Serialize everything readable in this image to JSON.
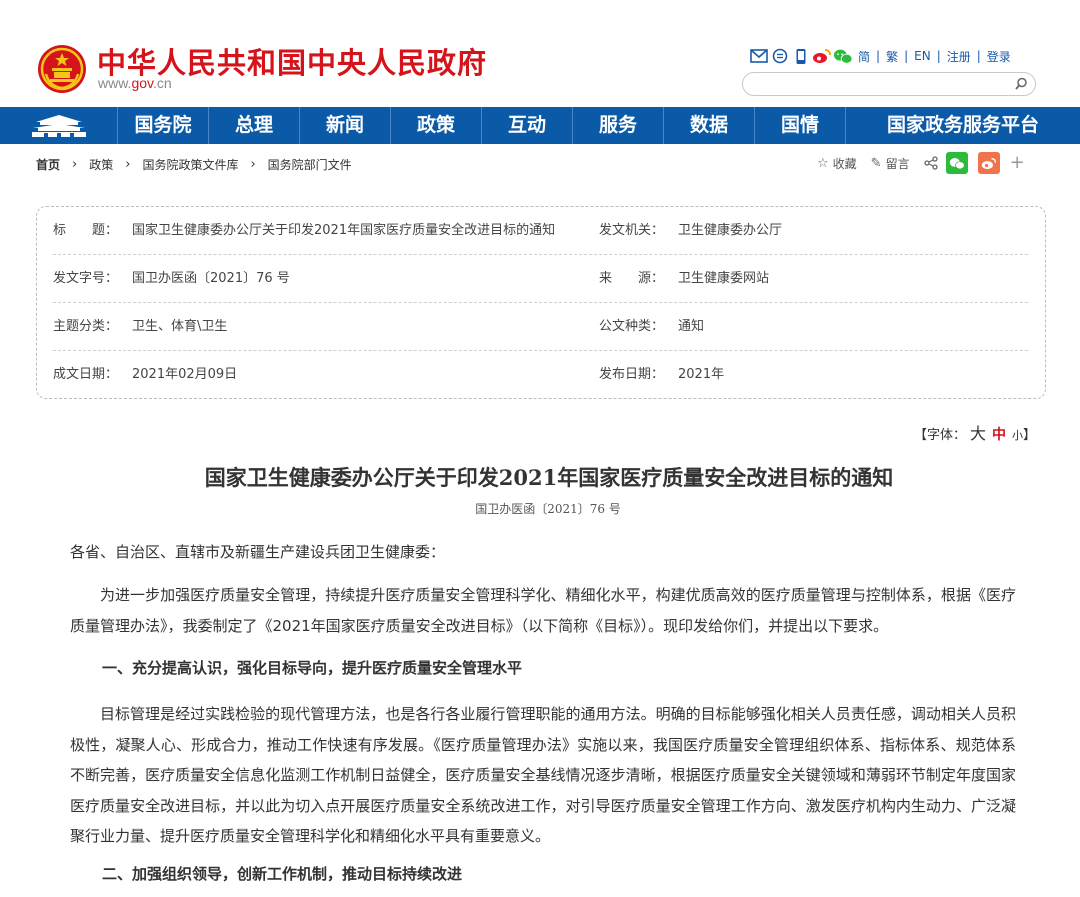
{
  "header": {
    "site_name": "中华人民共和国中央人民政府",
    "url_prefix": "www.",
    "url_domain": "gov",
    "url_suffix": ".cn",
    "top_links": [
      "简",
      "繁",
      "EN",
      "注册",
      "登录"
    ],
    "top_icons": [
      "mail-icon",
      "chat-icon",
      "mobile-icon",
      "weibo-icon",
      "wechat-icon"
    ],
    "search_placeholder": ""
  },
  "nav": {
    "items": [
      "国务院",
      "总理",
      "新闻",
      "政策",
      "互动",
      "服务",
      "数据",
      "国情",
      "国家政务服务平台"
    ]
  },
  "breadcrumb": {
    "items": [
      "首页",
      "政策",
      "国务院政策文件库",
      "国务院部门文件"
    ]
  },
  "tools": {
    "favorite": "收藏",
    "comment": "留言"
  },
  "info": {
    "title_label": "标　　题：",
    "title_value": "国家卫生健康委办公厅关于印发2021年国家医疗质量安全改进目标的通知",
    "issuer_label": "发文机关：",
    "issuer_value": "卫生健康委办公厅",
    "docno_label": "发文字号：",
    "docno_value": "国卫办医函〔2021〕76 号",
    "source_label": "来　　源：",
    "source_value": "卫生健康委网站",
    "topic_label": "主题分类：",
    "topic_value": "卫生、体育\\卫生",
    "type_label": "公文种类：",
    "type_value": "通知",
    "date_label": "成文日期：",
    "date_value": "2021年02月09日",
    "pub_label": "发布日期：",
    "pub_value": "2021年"
  },
  "font_size": {
    "open": "【字体：",
    "large": "大",
    "medium": "中",
    "small": "小",
    "close": "】"
  },
  "article": {
    "title": "国家卫生健康委办公厅关于印发2021年国家医疗质量安全改进目标的通知",
    "docno": "国卫办医函〔2021〕76 号",
    "salutation": "各省、自治区、直辖市及新疆生产建设兵团卫生健康委：",
    "p1": "为进一步加强医疗质量安全管理，持续提升医疗质量安全管理科学化、精细化水平，构建优质高效的医疗质量管理与控制体系，根据《医疗质量管理办法》，我委制定了《2021年国家医疗质量安全改进目标》（以下简称《目标》）。现印发给你们，并提出以下要求。",
    "h1": "一、充分提高认识，强化目标导向，提升医疗质量安全管理水平",
    "p2": "目标管理是经过实践检验的现代管理方法，也是各行各业履行管理职能的通用方法。明确的目标能够强化相关人员责任感，调动相关人员积极性，凝聚人心、形成合力，推动工作快速有序发展。《医疗质量管理办法》实施以来，我国医疗质量安全管理组织体系、指标体系、规范体系不断完善，医疗质量安全信息化监测工作机制日益健全，医疗质量安全基线情况逐步清晰，根据医疗质量安全关键领域和薄弱环节制定年度国家医疗质量安全改进目标，并以此为切入点开展医疗质量安全系统改进工作，对引导医疗质量安全管理工作方向、激发医疗机构内生动力、广泛凝聚行业力量、提升医疗质量安全管理科学化和精细化水平具有重要意义。",
    "h2": "二、加强组织领导，创新工作机制，推动目标持续改进"
  },
  "colors": {
    "brand_red": "#d4131b",
    "nav_blue": "#0b5aa8",
    "link_blue": "#1a5aa8"
  }
}
